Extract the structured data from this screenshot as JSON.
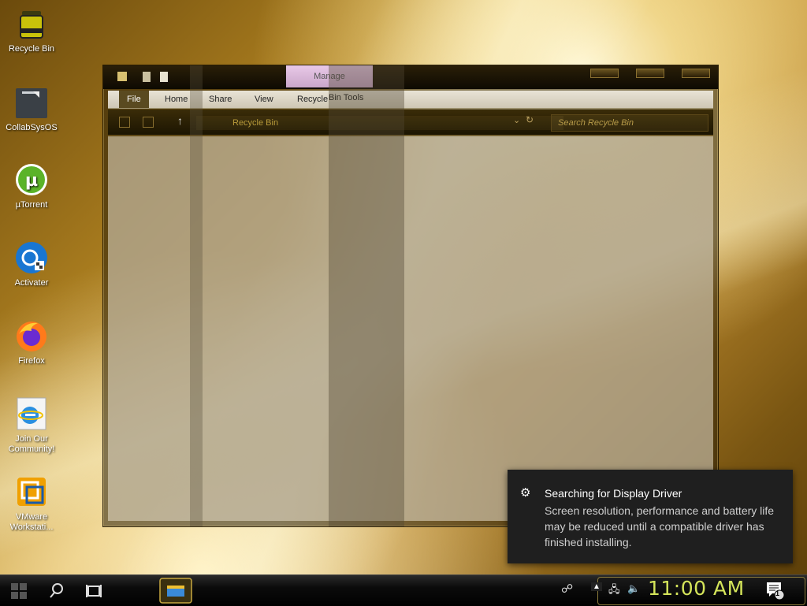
{
  "desktop": {
    "icons": [
      {
        "label": "Recycle Bin"
      },
      {
        "label": "CollabSysOS"
      },
      {
        "label": "µTorrent"
      },
      {
        "label": "Activater"
      },
      {
        "label": "Firefox"
      },
      {
        "label": "Join Our\nCommunity!"
      },
      {
        "label": "VMware\nWorkstati..."
      }
    ]
  },
  "explorer": {
    "tabs": [
      "File",
      "Home",
      "Share",
      "View",
      "Recycle"
    ],
    "context_tab": "Manage",
    "context_group": "Bin Tools",
    "address": "Recycle Bin",
    "search_placeholder": "Search Recycle Bin",
    "help_label": "?"
  },
  "toast": {
    "title": "Searching for Display Driver",
    "body": "Screen resolution, performance and battery life may be reduced until a compatible driver has finished installing."
  },
  "taskbar": {
    "clock": "11:00 AM",
    "notification_count": "1"
  },
  "colors": {
    "accent": "#d4e45a",
    "toast_bg": "#1f1f1f"
  }
}
